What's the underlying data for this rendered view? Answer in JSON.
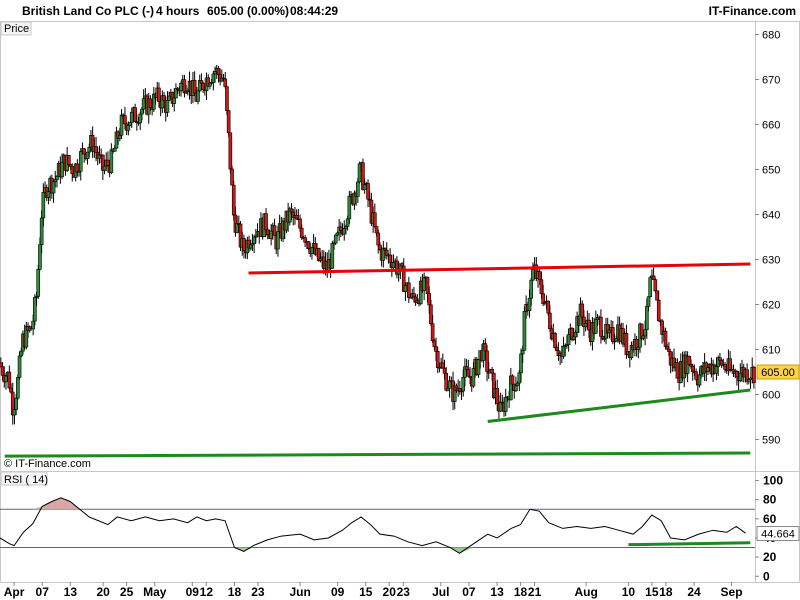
{
  "header": {
    "title": "British Land Co PLC (-)",
    "timeframe": "4 hours",
    "price": "605.00 (0.00%)",
    "time": "08:44:29",
    "brand": "IT-Finance.com"
  },
  "chart_data": [
    {
      "type": "candlestick",
      "panel_label": "Price",
      "copyright": "© IT-Finance.com",
      "ylim": [
        583,
        683
      ],
      "yticks": [
        590,
        600,
        610,
        620,
        630,
        640,
        650,
        660,
        670,
        680
      ],
      "last_price": "605.00",
      "x_start": "2021-03-29",
      "x_end": "2021-09-06",
      "xticks": [
        {
          "label": "Apr",
          "date": "2021-04-01",
          "bold": true
        },
        {
          "label": "07",
          "date": "2021-04-07"
        },
        {
          "label": "13",
          "date": "2021-04-13"
        },
        {
          "label": "20",
          "date": "2021-04-20"
        },
        {
          "label": "25",
          "date": "2021-04-25"
        },
        {
          "label": "May",
          "date": "2021-05-01",
          "bold": true
        },
        {
          "label": "09",
          "date": "2021-05-09"
        },
        {
          "label": "12",
          "date": "2021-05-12"
        },
        {
          "label": "18",
          "date": "2021-05-18"
        },
        {
          "label": "23",
          "date": "2021-05-23"
        },
        {
          "label": "Jun",
          "date": "2021-06-01",
          "bold": true
        },
        {
          "label": "09",
          "date": "2021-06-09"
        },
        {
          "label": "15",
          "date": "2021-06-15"
        },
        {
          "label": "20",
          "date": "2021-06-20"
        },
        {
          "label": "23",
          "date": "2021-06-23"
        },
        {
          "label": "Jul",
          "date": "2021-07-01",
          "bold": true
        },
        {
          "label": "07",
          "date": "2021-07-07"
        },
        {
          "label": "13",
          "date": "2021-07-13"
        },
        {
          "label": "18",
          "date": "2021-07-18"
        },
        {
          "label": "21",
          "date": "2021-07-21"
        },
        {
          "label": "Aug",
          "date": "2021-08-01",
          "bold": true
        },
        {
          "label": "10",
          "date": "2021-08-10"
        },
        {
          "label": "15",
          "date": "2021-08-15"
        },
        {
          "label": "18",
          "date": "2021-08-18"
        },
        {
          "label": "24",
          "date": "2021-08-24"
        },
        {
          "label": "Sep",
          "date": "2021-09-01",
          "bold": true
        }
      ],
      "close_path": [
        [
          "2021-03-29",
          607
        ],
        [
          "2021-03-30",
          605
        ],
        [
          "2021-03-31",
          604
        ],
        [
          "2021-04-01",
          597
        ],
        [
          "2021-04-02",
          603
        ],
        [
          "2021-04-03",
          612
        ],
        [
          "2021-04-05",
          615
        ],
        [
          "2021-04-06",
          622
        ],
        [
          "2021-04-07",
          640
        ],
        [
          "2021-04-08",
          646
        ],
        [
          "2021-04-10",
          648
        ],
        [
          "2021-04-12",
          652
        ],
        [
          "2021-04-14",
          650
        ],
        [
          "2021-04-16",
          654
        ],
        [
          "2021-04-18",
          656
        ],
        [
          "2021-04-20",
          650
        ],
        [
          "2021-04-22",
          652
        ],
        [
          "2021-04-24",
          660
        ],
        [
          "2021-04-27",
          662
        ],
        [
          "2021-04-29",
          664
        ],
        [
          "2021-05-02",
          666
        ],
        [
          "2021-05-04",
          664
        ],
        [
          "2021-05-06",
          668
        ],
        [
          "2021-05-08",
          670
        ],
        [
          "2021-05-10",
          666
        ],
        [
          "2021-05-12",
          670
        ],
        [
          "2021-05-14",
          672
        ],
        [
          "2021-05-16",
          670
        ],
        [
          "2021-05-17",
          656
        ],
        [
          "2021-05-18",
          640
        ],
        [
          "2021-05-20",
          632
        ],
        [
          "2021-05-22",
          636
        ],
        [
          "2021-05-25",
          638
        ],
        [
          "2021-05-27",
          634
        ],
        [
          "2021-05-30",
          640
        ],
        [
          "2021-06-02",
          636
        ],
        [
          "2021-06-05",
          630
        ],
        [
          "2021-06-07",
          628
        ],
        [
          "2021-06-09",
          634
        ],
        [
          "2021-06-11",
          640
        ],
        [
          "2021-06-13",
          646
        ],
        [
          "2021-06-14",
          650
        ],
        [
          "2021-06-16",
          642
        ],
        [
          "2021-06-18",
          632
        ],
        [
          "2021-06-21",
          630
        ],
        [
          "2021-06-23",
          626
        ],
        [
          "2021-06-25",
          621
        ],
        [
          "2021-06-28",
          624
        ],
        [
          "2021-06-30",
          610
        ],
        [
          "2021-07-02",
          604
        ],
        [
          "2021-07-04",
          600
        ],
        [
          "2021-07-06",
          604
        ],
        [
          "2021-07-08",
          604
        ],
        [
          "2021-07-10",
          610
        ],
        [
          "2021-07-12",
          603
        ],
        [
          "2021-07-14",
          596
        ],
        [
          "2021-07-16",
          602
        ],
        [
          "2021-07-18",
          604
        ],
        [
          "2021-07-19",
          616
        ],
        [
          "2021-07-21",
          628
        ],
        [
          "2021-07-23",
          622
        ],
        [
          "2021-07-25",
          614
        ],
        [
          "2021-07-27",
          608
        ],
        [
          "2021-07-29",
          614
        ],
        [
          "2021-07-31",
          618
        ],
        [
          "2021-08-02",
          614
        ],
        [
          "2021-08-04",
          616
        ],
        [
          "2021-08-06",
          612
        ],
        [
          "2021-08-08",
          615
        ],
        [
          "2021-08-10",
          610
        ],
        [
          "2021-08-12",
          612
        ],
        [
          "2021-08-14",
          616
        ],
        [
          "2021-08-15",
          626
        ],
        [
          "2021-08-17",
          616
        ],
        [
          "2021-08-19",
          608
        ],
        [
          "2021-08-21",
          605
        ],
        [
          "2021-08-23",
          608
        ],
        [
          "2021-08-25",
          604
        ],
        [
          "2021-08-27",
          606
        ],
        [
          "2021-08-30",
          607
        ],
        [
          "2021-09-01",
          605
        ],
        [
          "2021-09-03",
          605
        ]
      ],
      "trendlines": [
        {
          "color": "#e8000b",
          "from": [
            "2021-05-21",
            627
          ],
          "to": [
            "2021-09-05",
            629
          ]
        },
        {
          "color": "#1e8a1e",
          "from": [
            "2021-07-11",
            594
          ],
          "to": [
            "2021-09-05",
            601
          ]
        },
        {
          "color": "#1e8a1e",
          "from": [
            "2021-03-30",
            586.3
          ],
          "to": [
            "2021-09-05",
            587
          ]
        }
      ]
    },
    {
      "type": "line",
      "panel_label": "RSI ( 14)",
      "ylim": [
        -6,
        110
      ],
      "yticks": [
        0,
        20,
        40,
        60,
        80,
        100
      ],
      "levels": [
        30,
        70
      ],
      "last_value": "44.664",
      "series": [
        {
          "points": [
            [
              "2021-03-29",
              40
            ],
            [
              "2021-03-31",
              34
            ],
            [
              "2021-04-01",
              32
            ],
            [
              "2021-04-03",
              46
            ],
            [
              "2021-04-05",
              55
            ],
            [
              "2021-04-07",
              73
            ],
            [
              "2021-04-09",
              78
            ],
            [
              "2021-04-11",
              82
            ],
            [
              "2021-04-13",
              78
            ],
            [
              "2021-04-15",
              70
            ],
            [
              "2021-04-17",
              62
            ],
            [
              "2021-04-19",
              58
            ],
            [
              "2021-04-21",
              54
            ],
            [
              "2021-04-23",
              62
            ],
            [
              "2021-04-26",
              58
            ],
            [
              "2021-04-29",
              62
            ],
            [
              "2021-05-02",
              58
            ],
            [
              "2021-05-05",
              60
            ],
            [
              "2021-05-08",
              56
            ],
            [
              "2021-05-10",
              62
            ],
            [
              "2021-05-12",
              58
            ],
            [
              "2021-05-14",
              60
            ],
            [
              "2021-05-16",
              58
            ],
            [
              "2021-05-18",
              30
            ],
            [
              "2021-05-20",
              26
            ],
            [
              "2021-05-22",
              32
            ],
            [
              "2021-05-25",
              38
            ],
            [
              "2021-05-28",
              42
            ],
            [
              "2021-06-01",
              44
            ],
            [
              "2021-06-04",
              38
            ],
            [
              "2021-06-07",
              40
            ],
            [
              "2021-06-10",
              48
            ],
            [
              "2021-06-12",
              56
            ],
            [
              "2021-06-14",
              62
            ],
            [
              "2021-06-16",
              54
            ],
            [
              "2021-06-18",
              44
            ],
            [
              "2021-06-21",
              42
            ],
            [
              "2021-06-24",
              36
            ],
            [
              "2021-06-27",
              32
            ],
            [
              "2021-06-30",
              36
            ],
            [
              "2021-07-03",
              30
            ],
            [
              "2021-07-05",
              24
            ],
            [
              "2021-07-08",
              34
            ],
            [
              "2021-07-11",
              44
            ],
            [
              "2021-07-13",
              40
            ],
            [
              "2021-07-16",
              50
            ],
            [
              "2021-07-18",
              54
            ],
            [
              "2021-07-20",
              70
            ],
            [
              "2021-07-22",
              68
            ],
            [
              "2021-07-24",
              56
            ],
            [
              "2021-07-27",
              50
            ],
            [
              "2021-07-30",
              52
            ],
            [
              "2021-08-02",
              50
            ],
            [
              "2021-08-05",
              52
            ],
            [
              "2021-08-08",
              48
            ],
            [
              "2021-08-11",
              44
            ],
            [
              "2021-08-13",
              52
            ],
            [
              "2021-08-15",
              64
            ],
            [
              "2021-08-17",
              58
            ],
            [
              "2021-08-19",
              40
            ],
            [
              "2021-08-22",
              38
            ],
            [
              "2021-08-25",
              44
            ],
            [
              "2021-08-28",
              48
            ],
            [
              "2021-08-31",
              46
            ],
            [
              "2021-09-02",
              52
            ],
            [
              "2021-09-04",
              45
            ]
          ]
        }
      ],
      "trendlines": [
        {
          "color": "#1e8a1e",
          "from": [
            "2021-08-10",
            33
          ],
          "to": [
            "2021-09-05",
            35
          ]
        }
      ]
    }
  ]
}
